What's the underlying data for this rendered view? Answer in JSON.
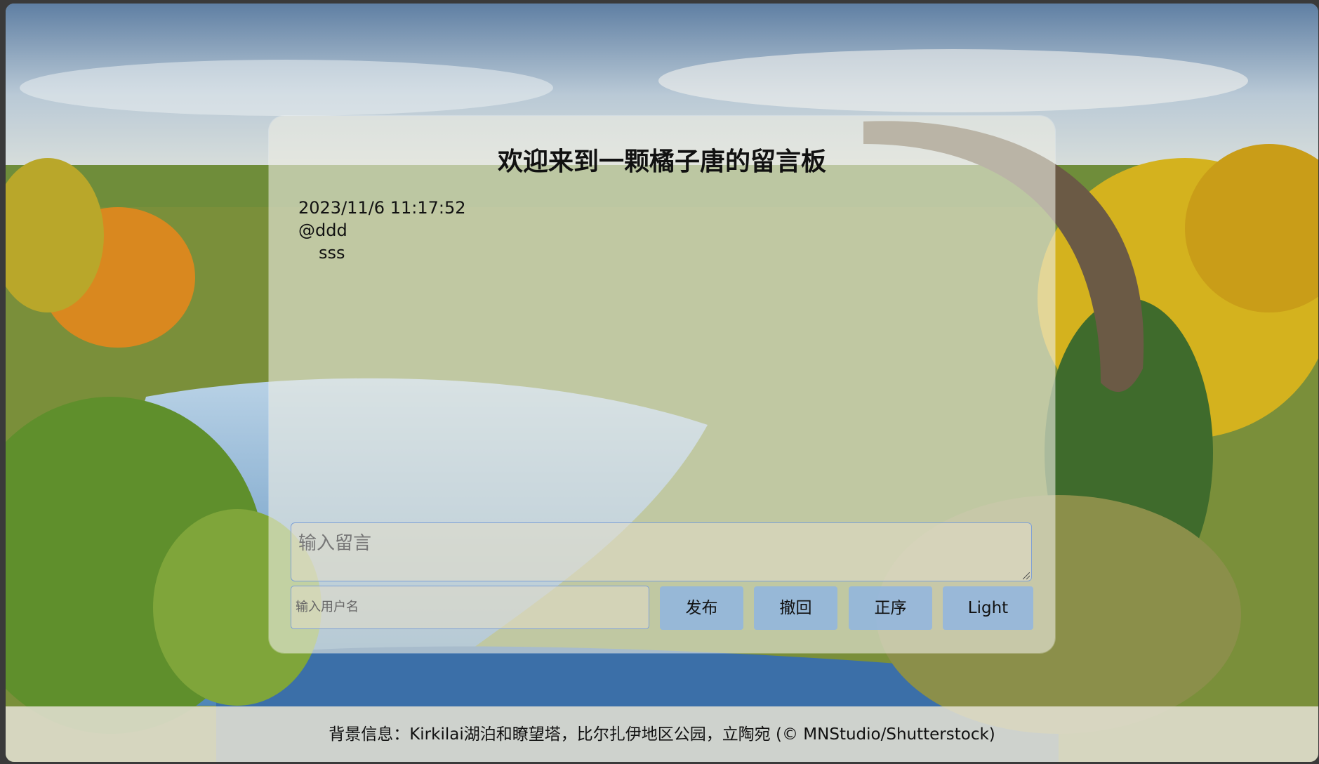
{
  "board": {
    "title": "欢迎来到一颗橘子唐的留言板",
    "messages": [
      {
        "time": "2023/11/6 11:17:52",
        "user": "@ddd",
        "content": "sss"
      }
    ],
    "message_input": {
      "placeholder": "输入留言"
    },
    "username_input": {
      "placeholder": "输入用户名"
    },
    "buttons": {
      "publish": "发布",
      "withdraw": "撤回",
      "order": "正序",
      "theme": "Light"
    }
  },
  "footer": {
    "text": "背景信息：Kirkilai湖泊和瞭望塔，比尔扎伊地区公园，立陶宛 (© MNStudio/Shutterstock)"
  },
  "colors": {
    "button_bg": "#8cb4e6",
    "input_border": "#7ea0d6"
  }
}
